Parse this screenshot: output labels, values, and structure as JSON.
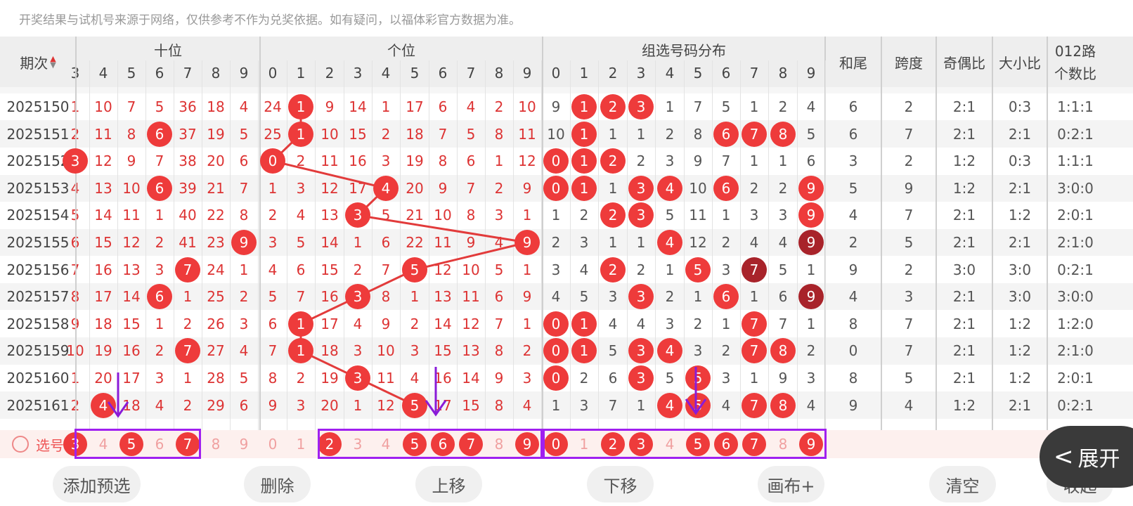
{
  "notice": "开奖结果与试机号来源于网络，仅供参考不作为兑奖依据。如有疑问，以福体彩官方数据为准。",
  "headers": {
    "issue": "期次",
    "tens": "十位",
    "units": "个位",
    "group": "组选号码分布",
    "sum_tail": "和尾",
    "span": "跨度",
    "odd_even": "奇偶比",
    "big_small": "大小比",
    "route_1": "012路",
    "route_2": "个数比"
  },
  "tens_digits": [
    "3",
    "4",
    "5",
    "6",
    "7",
    "8",
    "9"
  ],
  "digits": [
    "0",
    "1",
    "2",
    "3",
    "4",
    "5",
    "6",
    "7",
    "8",
    "9"
  ],
  "rows": [
    {
      "issue": "2025150",
      "tens": [
        "1",
        "10",
        "7",
        "5",
        "36",
        "18",
        "4"
      ],
      "units": [
        "24",
        "1",
        "9",
        "14",
        "1",
        "17",
        "6",
        "4",
        "2",
        "10"
      ],
      "group": [
        "9",
        "1",
        "2",
        "3",
        "1",
        "7",
        "5",
        "1",
        "2",
        "4"
      ],
      "sum_tail": "6",
      "span": "2",
      "odd_even": "2:1",
      "big_small": "0:3",
      "route": "1:1:1"
    },
    {
      "issue": "2025151",
      "tens": [
        "2",
        "11",
        "8",
        "6",
        "37",
        "19",
        "5"
      ],
      "units": [
        "25",
        "1",
        "10",
        "15",
        "2",
        "18",
        "7",
        "5",
        "8",
        "11"
      ],
      "group": [
        "10",
        "1",
        "1",
        "1",
        "2",
        "8",
        "6",
        "7",
        "8",
        "5"
      ],
      "sum_tail": "6",
      "span": "7",
      "odd_even": "2:1",
      "big_small": "2:1",
      "route": "0:2:1"
    },
    {
      "issue": "2025152",
      "tens": [
        "3",
        "12",
        "9",
        "7",
        "38",
        "20",
        "6"
      ],
      "units": [
        "0",
        "2",
        "11",
        "16",
        "3",
        "19",
        "8",
        "6",
        "1",
        "12"
      ],
      "group": [
        "0",
        "1",
        "2",
        "2",
        "3",
        "9",
        "7",
        "1",
        "1",
        "6"
      ],
      "sum_tail": "3",
      "span": "2",
      "odd_even": "1:2",
      "big_small": "0:3",
      "route": "1:1:1"
    },
    {
      "issue": "2025153",
      "tens": [
        "4",
        "13",
        "10",
        "6",
        "39",
        "21",
        "7"
      ],
      "units": [
        "1",
        "3",
        "12",
        "17",
        "4",
        "20",
        "9",
        "7",
        "2",
        "9"
      ],
      "group": [
        "0",
        "1",
        "1",
        "3",
        "4",
        "10",
        "6",
        "2",
        "2",
        "9"
      ],
      "sum_tail": "5",
      "span": "9",
      "odd_even": "1:2",
      "big_small": "2:1",
      "route": "3:0:0"
    },
    {
      "issue": "2025154",
      "tens": [
        "5",
        "14",
        "11",
        "1",
        "40",
        "22",
        "8"
      ],
      "units": [
        "2",
        "4",
        "13",
        "3",
        "5",
        "21",
        "10",
        "8",
        "3",
        "1"
      ],
      "group": [
        "1",
        "2",
        "2",
        "3",
        "5",
        "11",
        "1",
        "3",
        "3",
        "9"
      ],
      "sum_tail": "4",
      "span": "7",
      "odd_even": "2:1",
      "big_small": "1:2",
      "route": "2:0:1"
    },
    {
      "issue": "2025155",
      "tens": [
        "6",
        "15",
        "12",
        "2",
        "41",
        "23",
        "9"
      ],
      "units": [
        "3",
        "5",
        "14",
        "1",
        "6",
        "22",
        "11",
        "9",
        "4",
        "9"
      ],
      "group": [
        "2",
        "3",
        "1",
        "1",
        "4",
        "12",
        "2",
        "4",
        "4",
        "9"
      ],
      "sum_tail": "2",
      "span": "5",
      "odd_even": "2:1",
      "big_small": "2:1",
      "route": "2:1:0"
    },
    {
      "issue": "2025156",
      "tens": [
        "7",
        "16",
        "13",
        "3",
        "7",
        "24",
        "1"
      ],
      "units": [
        "4",
        "6",
        "15",
        "2",
        "7",
        "5",
        "12",
        "10",
        "5",
        "1"
      ],
      "group": [
        "3",
        "4",
        "2",
        "2",
        "1",
        "5",
        "3",
        "7",
        "5",
        "1"
      ],
      "sum_tail": "9",
      "span": "2",
      "odd_even": "3:0",
      "big_small": "3:0",
      "route": "0:2:1"
    },
    {
      "issue": "2025157",
      "tens": [
        "8",
        "17",
        "14",
        "6",
        "1",
        "25",
        "2"
      ],
      "units": [
        "5",
        "7",
        "16",
        "3",
        "8",
        "1",
        "13",
        "11",
        "6",
        "9"
      ],
      "group": [
        "4",
        "5",
        "3",
        "3",
        "2",
        "1",
        "6",
        "1",
        "6",
        "9"
      ],
      "sum_tail": "4",
      "span": "3",
      "odd_even": "2:1",
      "big_small": "3:0",
      "route": "3:0:0"
    },
    {
      "issue": "2025158",
      "tens": [
        "9",
        "18",
        "15",
        "1",
        "2",
        "26",
        "3"
      ],
      "units": [
        "6",
        "1",
        "17",
        "4",
        "9",
        "2",
        "14",
        "12",
        "7",
        "1"
      ],
      "group": [
        "0",
        "1",
        "4",
        "4",
        "3",
        "2",
        "1",
        "7",
        "7",
        "1"
      ],
      "sum_tail": "8",
      "span": "7",
      "odd_even": "2:1",
      "big_small": "1:2",
      "route": "1:2:0"
    },
    {
      "issue": "2025159",
      "tens": [
        "10",
        "19",
        "16",
        "2",
        "7",
        "27",
        "4"
      ],
      "units": [
        "7",
        "1",
        "18",
        "3",
        "10",
        "3",
        "15",
        "13",
        "8",
        "2"
      ],
      "group": [
        "0",
        "1",
        "5",
        "3",
        "4",
        "3",
        "2",
        "7",
        "8",
        "2"
      ],
      "sum_tail": "0",
      "span": "7",
      "odd_even": "2:1",
      "big_small": "1:2",
      "route": "2:1:0"
    },
    {
      "issue": "2025160",
      "tens": [
        "1",
        "20",
        "17",
        "3",
        "1",
        "28",
        "5"
      ],
      "units": [
        "8",
        "2",
        "19",
        "3",
        "11",
        "4",
        "16",
        "14",
        "9",
        "3"
      ],
      "group": [
        "0",
        "2",
        "6",
        "3",
        "5",
        "5",
        "3",
        "1",
        "9",
        "3"
      ],
      "sum_tail": "8",
      "span": "5",
      "odd_even": "2:1",
      "big_small": "1:2",
      "route": "2:0:1"
    },
    {
      "issue": "2025161",
      "tens": [
        "2",
        "4",
        "18",
        "4",
        "2",
        "29",
        "6"
      ],
      "units": [
        "9",
        "3",
        "20",
        "1",
        "12",
        "5",
        "17",
        "15",
        "8",
        "4"
      ],
      "group": [
        "1",
        "3",
        "7",
        "1",
        "4",
        "5",
        "4",
        "7",
        "8",
        "4"
      ],
      "sum_tail": "9",
      "span": "4",
      "odd_even": "1:2",
      "big_small": "2:1",
      "route": "0:2:1"
    }
  ],
  "selection": {
    "label": "选号",
    "tens": [
      "3",
      "4",
      "5",
      "6",
      "7",
      "8",
      "9"
    ],
    "units": [
      "0",
      "1",
      "2",
      "3",
      "4",
      "5",
      "6",
      "7",
      "8",
      "9"
    ],
    "group": [
      "0",
      "1",
      "2",
      "3",
      "4",
      "5",
      "6",
      "7",
      "8",
      "9"
    ]
  },
  "buttons": {
    "add": "添加预选",
    "delete": "删除",
    "up": "上移",
    "down": "下移",
    "canvas": "画布+",
    "clear": "清空",
    "collapse": "收起"
  },
  "expand_label": "展开",
  "colors": {
    "ball": "#ee3b3b",
    "ball_dark": "#a8232a",
    "line": "#e23b3b",
    "arrow": "#8a1bd8",
    "highlight": "#a020f0"
  }
}
